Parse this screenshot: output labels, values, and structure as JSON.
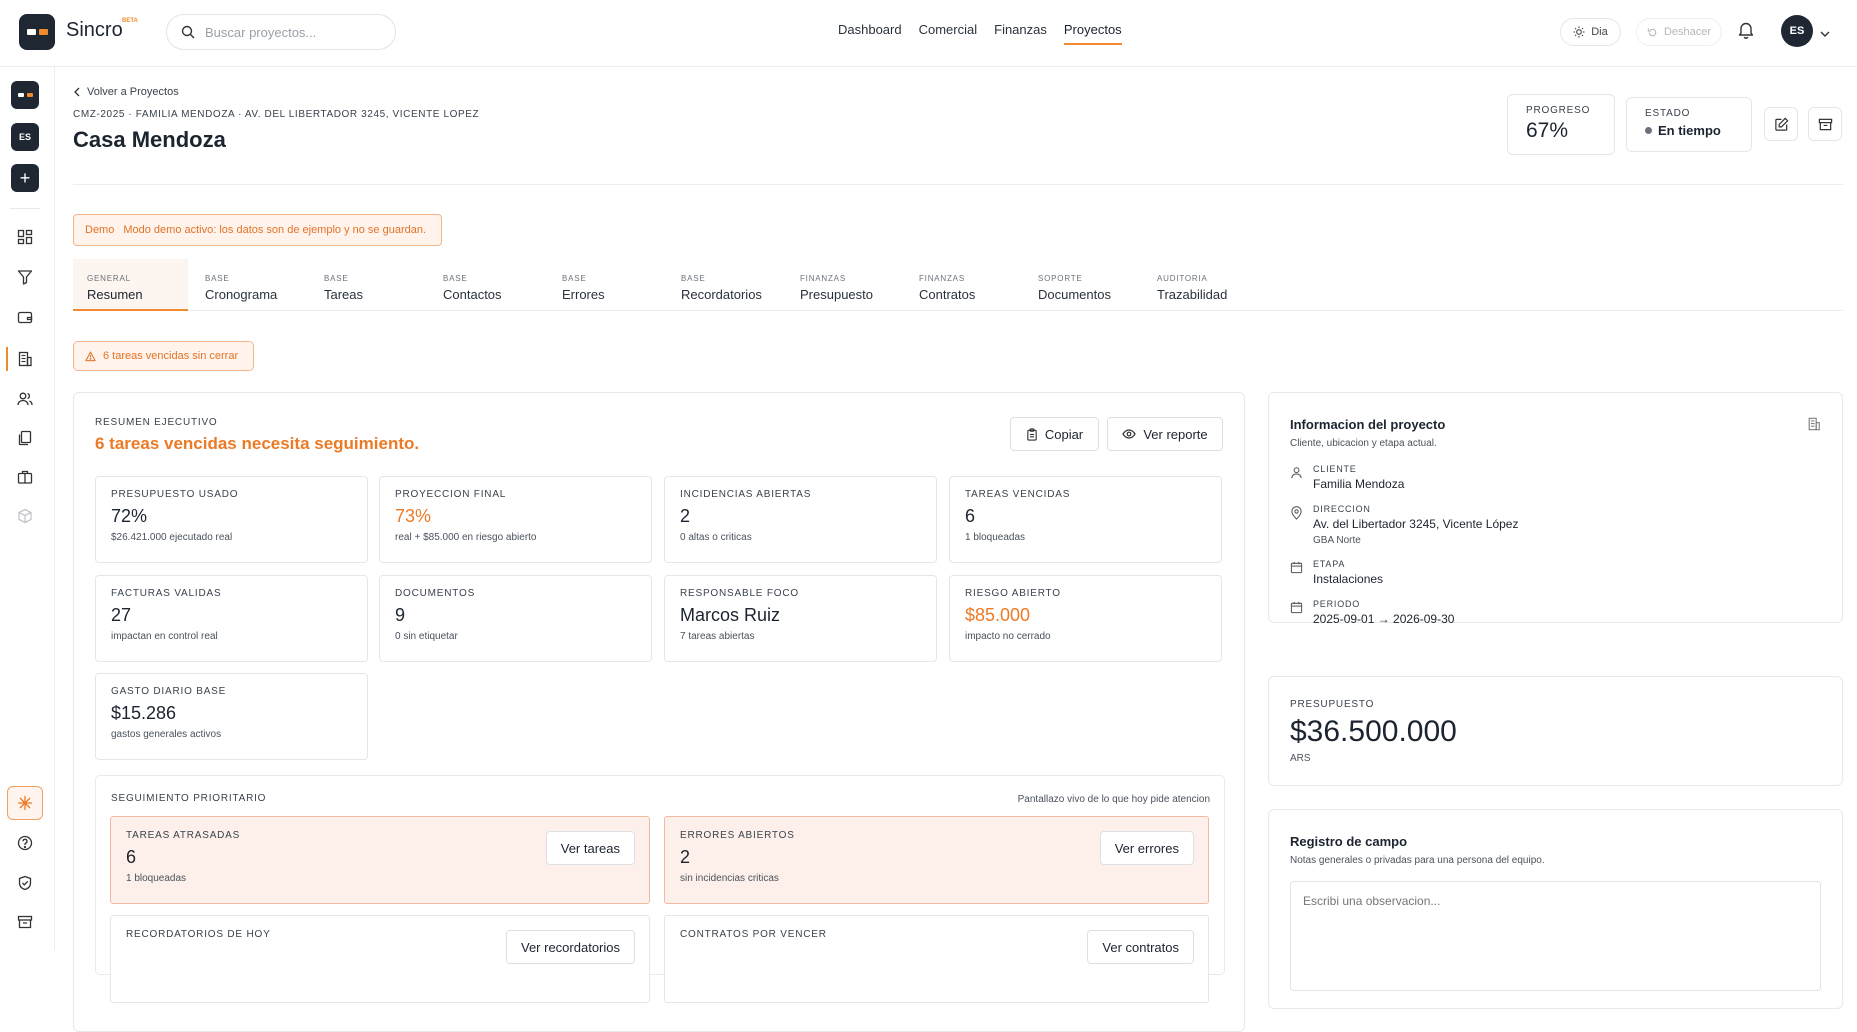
{
  "app": {
    "brand": "Sincro",
    "brand_badge": "BETA"
  },
  "search": {
    "placeholder": "Buscar proyectos..."
  },
  "nav": [
    "Dashboard",
    "Comercial",
    "Finanzas",
    "Proyectos"
  ],
  "nav_active": "Proyectos",
  "top_actions": {
    "theme_label": "Dia",
    "undo_label": "Deshacer",
    "avatar_initials": "ES"
  },
  "sidebar": {
    "workspace_initials": "ES",
    "icons": [
      "dashboard-icon",
      "funnel-icon",
      "wallet-icon",
      "building-icon",
      "users-icon",
      "documents-icon",
      "briefcase-icon",
      "box-icon",
      "ai-sparkle-icon",
      "help-icon",
      "shield-icon",
      "archive-icon"
    ],
    "active": "building-icon"
  },
  "header": {
    "back_label": "Volver a Proyectos",
    "breadcrumb": "CMZ-2025 · FAMILIA MENDOZA · AV. DEL LIBERTADOR 3245, VICENTE LOPEZ",
    "title": "Casa Mendoza",
    "progress_label": "PROGRESO",
    "progress_value": "67%",
    "status_label": "ESTADO",
    "status_value": "En tiempo"
  },
  "demo_banner": {
    "tag": "Demo",
    "text": "Modo demo activo: los datos son de ejemplo y no se guardan."
  },
  "tabs": [
    {
      "group": "GENERAL",
      "label": "Resumen",
      "active": true
    },
    {
      "group": "BASE",
      "label": "Cronograma"
    },
    {
      "group": "BASE",
      "label": "Tareas"
    },
    {
      "group": "BASE",
      "label": "Contactos"
    },
    {
      "group": "BASE",
      "label": "Errores"
    },
    {
      "group": "BASE",
      "label": "Recordatorios"
    },
    {
      "group": "FINANZAS",
      "label": "Presupuesto"
    },
    {
      "group": "FINANZAS",
      "label": "Contratos"
    },
    {
      "group": "SOPORTE",
      "label": "Documentos"
    },
    {
      "group": "AUDITORIA",
      "label": "Trazabilidad"
    }
  ],
  "alert": {
    "text": "6 tareas vencidas sin cerrar"
  },
  "executive": {
    "label": "RESUMEN EJECUTIVO",
    "headline": "6 tareas vencidas necesita seguimiento.",
    "copy_label": "Copiar",
    "report_label": "Ver reporte"
  },
  "kpis": [
    {
      "label": "PRESUPUESTO USADO",
      "value": "72%",
      "sub": "$26.421.000 ejecutado real",
      "accent": false
    },
    {
      "label": "PROYECCION FINAL",
      "value": "73%",
      "sub": "real + $85.000 en riesgo abierto",
      "accent": true
    },
    {
      "label": "INCIDENCIAS ABIERTAS",
      "value": "2",
      "sub": "0 altas o criticas",
      "accent": false
    },
    {
      "label": "TAREAS VENCIDAS",
      "value": "6",
      "sub": "1 bloqueadas",
      "accent": false
    },
    {
      "label": "FACTURAS VALIDAS",
      "value": "27",
      "sub": "impactan en control real",
      "accent": false
    },
    {
      "label": "DOCUMENTOS",
      "value": "9",
      "sub": "0 sin etiquetar",
      "accent": false
    },
    {
      "label": "RESPONSABLE FOCO",
      "value": "Marcos Ruiz",
      "sub": "7 tareas abiertas",
      "accent": false
    },
    {
      "label": "RIESGO ABIERTO",
      "value": "$85.000",
      "sub": "impacto no cerrado",
      "accent": true
    },
    {
      "label": "GASTO DIARIO BASE",
      "value": "$15.286",
      "sub": "gastos generales activos",
      "accent": false
    }
  ],
  "followup": {
    "label": "SEGUIMIENTO PRIORITARIO",
    "note": "Pantallazo vivo de lo que hoy pide atencion",
    "cards": [
      {
        "label": "TAREAS ATRASADAS",
        "value": "6",
        "sub": "1 bloqueadas",
        "button": "Ver tareas"
      },
      {
        "label": "ERRORES ABIERTOS",
        "value": "2",
        "sub": "sin incidencias criticas",
        "button": "Ver errores"
      },
      {
        "label": "RECORDATORIOS DE HOY",
        "value": "",
        "sub": "",
        "button": "Ver recordatorios"
      },
      {
        "label": "CONTRATOS POR VENCER",
        "value": "",
        "sub": "",
        "button": "Ver contratos"
      }
    ]
  },
  "info": {
    "title": "Informacion del proyecto",
    "subtitle": "Cliente, ubicacion y etapa actual.",
    "client_label": "CLIENTE",
    "client": "Familia Mendoza",
    "address_label": "DIRECCION",
    "address": "Av. del Libertador 3245, Vicente López",
    "zone": "GBA Norte",
    "stage_label": "ETAPA",
    "stage": "Instalaciones",
    "period_label": "PERIODO",
    "period": "2025-09-01 → 2026-09-30"
  },
  "budget": {
    "label": "PRESUPUESTO",
    "value": "$36.500.000",
    "currency": "ARS"
  },
  "field_log": {
    "title": "Registro de campo",
    "subtitle": "Notas generales o privadas para una persona del equipo.",
    "placeholder": "Escribi una observacion..."
  }
}
